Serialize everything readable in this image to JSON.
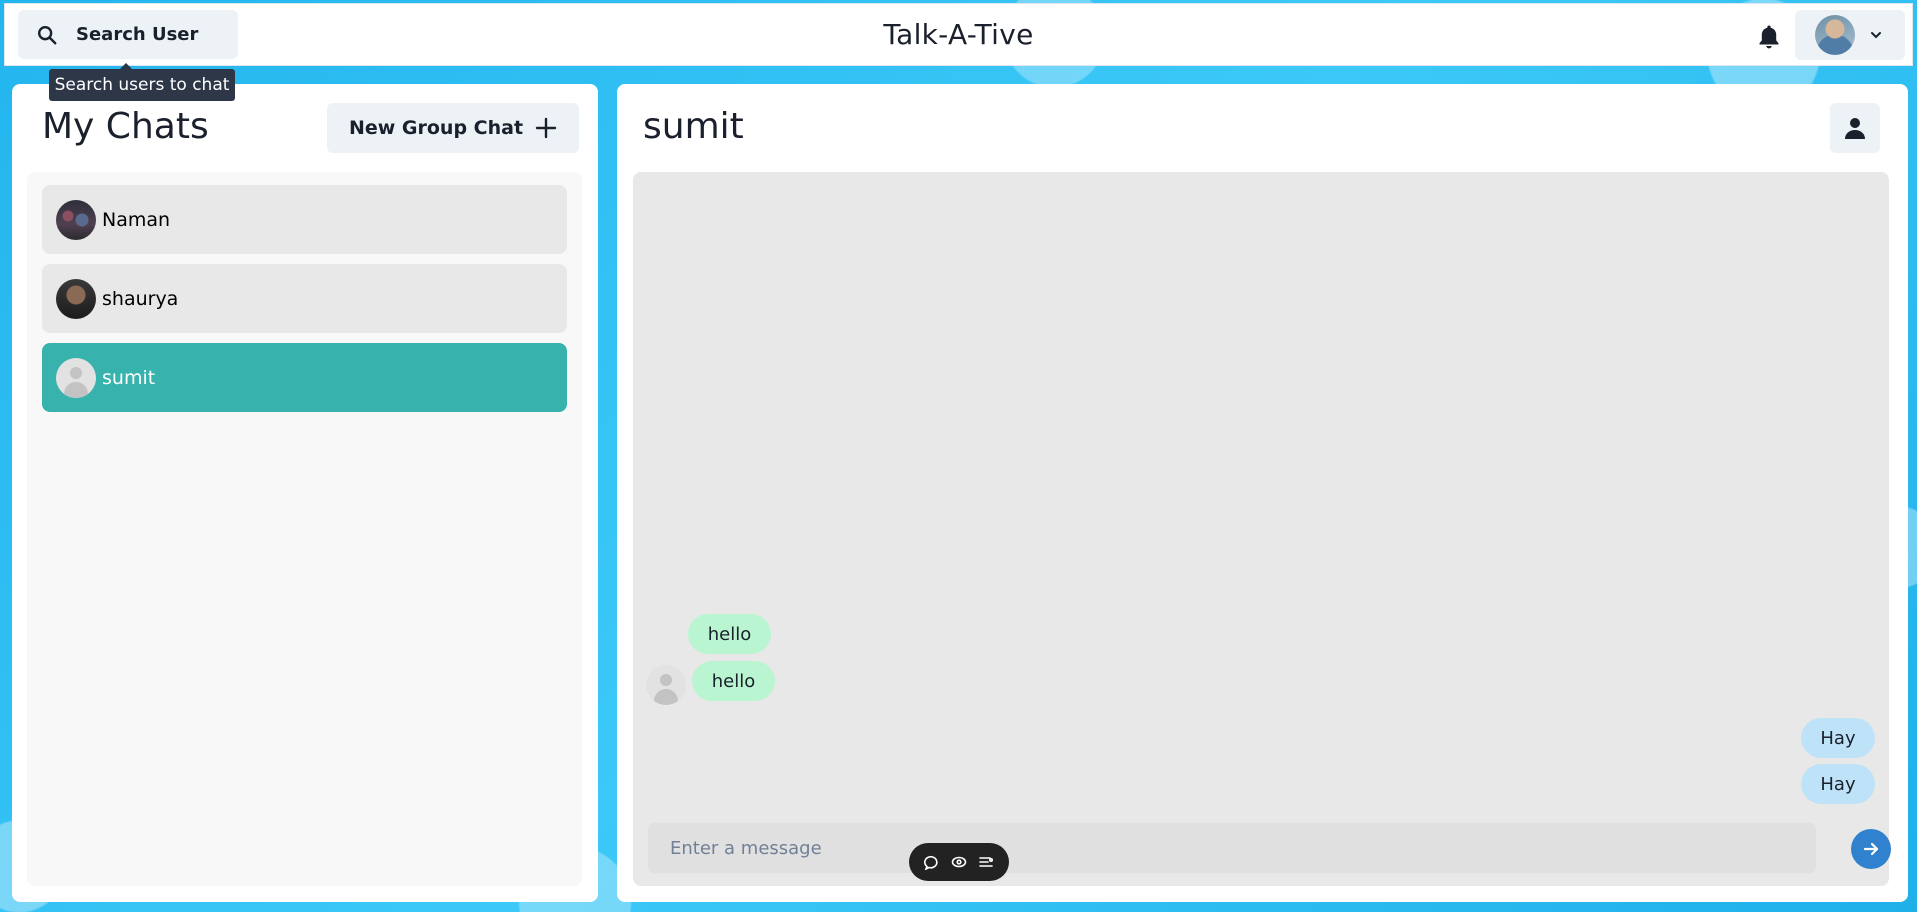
{
  "header": {
    "search_label": "Search User",
    "search_tooltip": "Search users to chat",
    "app_title": "Talk-A-Tive",
    "icons": {
      "search": "search-icon",
      "bell": "bell-icon",
      "chevron": "chevron-down-icon"
    }
  },
  "sidebar": {
    "title": "My Chats",
    "new_group_label": "New Group Chat",
    "chats": [
      {
        "name": "Naman",
        "selected": false
      },
      {
        "name": "shaurya",
        "selected": false
      },
      {
        "name": "sumit",
        "selected": true
      }
    ]
  },
  "chat": {
    "title": "sumit",
    "messages": [
      {
        "text": "hello",
        "direction": "in"
      },
      {
        "text": "hello",
        "direction": "in"
      },
      {
        "text": "Hay",
        "direction": "out"
      },
      {
        "text": "Hay",
        "direction": "out"
      }
    ],
    "input_placeholder": "Enter a message"
  },
  "colors": {
    "accent_selected": "#38b2ac",
    "bubble_in": "#b9f5d0",
    "bubble_out": "#bee3f8",
    "send_button": "#3182ce"
  }
}
